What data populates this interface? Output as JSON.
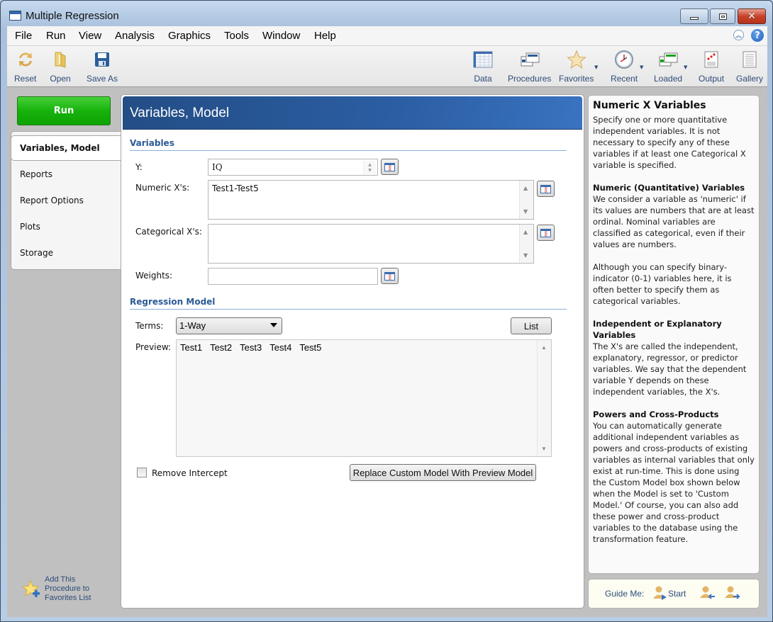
{
  "window": {
    "title": "Multiple Regression",
    "controls": {
      "minimize": "minimize",
      "maximize": "maximize",
      "close": "✕"
    }
  },
  "menu": {
    "items": [
      "File",
      "Run",
      "View",
      "Analysis",
      "Graphics",
      "Tools",
      "Window",
      "Help"
    ],
    "collapse_icon": "︽",
    "help_icon": "?"
  },
  "toolbar": {
    "left": [
      {
        "label": "Reset",
        "icon": "reset-icon"
      },
      {
        "label": "Open",
        "icon": "open-folder-icon"
      },
      {
        "label": "Save As",
        "icon": "save-icon"
      }
    ],
    "right": [
      {
        "label": "Data",
        "icon": "data-grid-icon"
      },
      {
        "label": "Procedures",
        "icon": "procedures-icon"
      },
      {
        "label": "Favorites",
        "icon": "star-icon",
        "dropdown": true
      },
      {
        "label": "Recent",
        "icon": "clock-icon",
        "dropdown": true
      },
      {
        "label": "Loaded",
        "icon": "loaded-windows-icon",
        "dropdown": true
      },
      {
        "label": "Output",
        "icon": "output-icon"
      },
      {
        "label": "Gallery",
        "icon": "gallery-icon"
      }
    ]
  },
  "sidebar": {
    "run_label": "Run",
    "items": [
      {
        "label": "Variables, Model",
        "active": true
      },
      {
        "label": "Reports",
        "active": false
      },
      {
        "label": "Report Options",
        "active": false
      },
      {
        "label": "Plots",
        "active": false
      },
      {
        "label": "Storage",
        "active": false
      }
    ],
    "favorites_text": [
      "Add This",
      "Procedure to",
      "Favorites List"
    ]
  },
  "main": {
    "title": "Variables, Model",
    "variables_section": "Variables",
    "fields": {
      "y": {
        "label": "Y:",
        "value": "IQ"
      },
      "numeric_x": {
        "label": "Numeric X's:",
        "value": "Test1-Test5"
      },
      "categorical_x": {
        "label": "Categorical X's:",
        "value": ""
      },
      "weights": {
        "label": "Weights:",
        "value": ""
      }
    },
    "model_section": "Regression Model",
    "terms": {
      "label": "Terms:",
      "value": "1-Way"
    },
    "list_button": "List",
    "preview": {
      "label": "Preview:",
      "terms": [
        "Test1",
        "Test2",
        "Test3",
        "Test4",
        "Test5"
      ]
    },
    "remove_intercept": {
      "label": "Remove Intercept",
      "checked": false
    },
    "replace_button": "Replace Custom Model With Preview Model"
  },
  "help": {
    "title": "Numeric X Variables",
    "intro": "Specify one or more quantitative independent variables. It is not necessary to specify any of these variables if at least one Categorical X variable is specified.",
    "sections": [
      {
        "heading": "Numeric (Quantitative) Variables",
        "body": "We consider a variable as 'numeric' if its values are numbers that are at least ordinal. Nominal variables are classified as categorical, even if their values are numbers."
      },
      {
        "heading": "",
        "body": "Although you can specify binary-indicator (0-1) variables here, it is often better to specify them as categorical variables."
      },
      {
        "heading": "Independent or Explanatory Variables",
        "body": "The X's are called the independent, explanatory, regressor, or predictor variables. We say that the dependent variable Y depends on these independent variables, the X's."
      },
      {
        "heading": "Powers and Cross-Products",
        "body": "You can automatically generate additional independent variables as powers and cross-products of existing variables as internal variables that only exist at run-time. This is done using the Custom Model box shown below when the Model is set to 'Custom Model.' Of course, you can also add these power and cross-product variables to the database using the transformation feature."
      }
    ]
  },
  "guide": {
    "label": "Guide Me:",
    "start_label": "Start"
  },
  "colors": {
    "run_green": "#17b20c",
    "header_blue": "#2b5ea3",
    "section_blue": "#2a5a96",
    "link_blue": "#2d4c78"
  }
}
